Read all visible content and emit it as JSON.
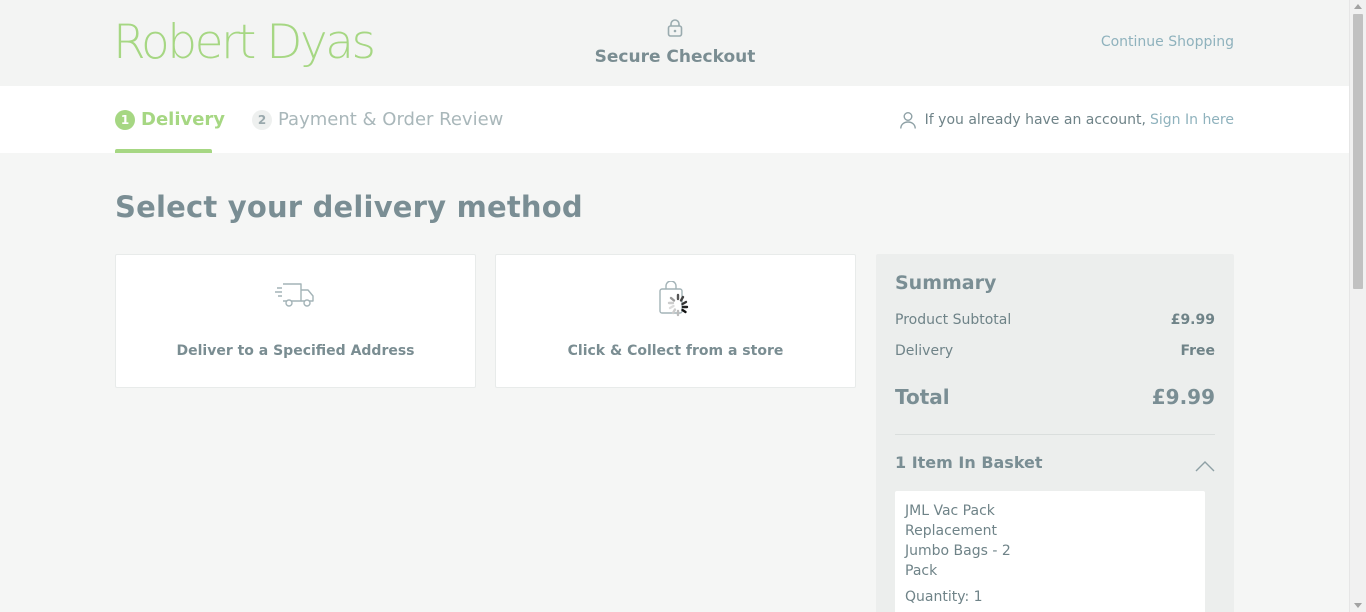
{
  "header": {
    "logo": "Robert Dyas",
    "secure_label": "Secure Checkout",
    "continue_link": "Continue Shopping"
  },
  "steps": [
    {
      "number": "1",
      "label": "Delivery",
      "active": true
    },
    {
      "number": "2",
      "label": "Payment & Order Review",
      "active": false
    }
  ],
  "account": {
    "prompt": "If you already have an account,",
    "sign_in": "Sign In here"
  },
  "main": {
    "heading": "Select your delivery method",
    "options": [
      {
        "label": "Deliver to a Specified Address",
        "icon": "truck-icon"
      },
      {
        "label": "Click & Collect from a store",
        "icon": "shopping-bag-icon"
      }
    ]
  },
  "summary": {
    "title": "Summary",
    "subtotal_label": "Product Subtotal",
    "subtotal_value": "£9.99",
    "delivery_label": "Delivery",
    "delivery_value": "Free",
    "total_label": "Total",
    "total_value": "£9.99",
    "basket_title": "1 Item In Basket",
    "items": [
      {
        "name": "JML Vac Pack Replacement Jumbo Bags - 2 Pack",
        "quantity": "Quantity: 1"
      }
    ]
  },
  "colors": {
    "brand_green": "#a6d783",
    "link_blue": "#8fb2bd",
    "text_grey": "#7a8e94",
    "background": "#f5f6f5"
  }
}
